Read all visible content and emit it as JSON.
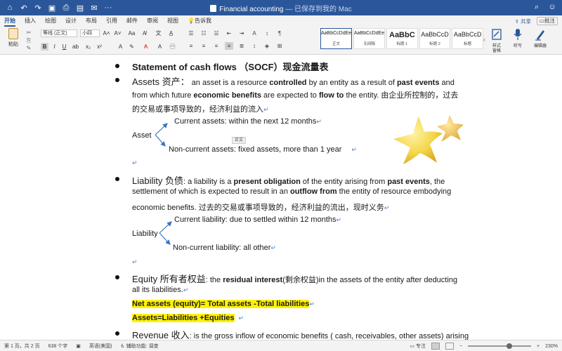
{
  "window": {
    "title": "Financial accounting",
    "subtitle": "— 已保存到我的 Mac"
  },
  "tabs": [
    "开始",
    "插入",
    "绘图",
    "设计",
    "布局",
    "引用",
    "邮件",
    "审阅",
    "视图"
  ],
  "tell_me": "告诉我",
  "share_label": "共享",
  "comments_label": "批注",
  "ribbon": {
    "paste_label": "粘贴",
    "font_name": "等线 (正文)",
    "font_size": "小四",
    "styles": [
      {
        "preview": "AaBbCcDdEe",
        "name": "正文"
      },
      {
        "preview": "AaBbCcDdEe",
        "name": "无间隔"
      },
      {
        "preview": "AaBbC",
        "name": "标题 1"
      },
      {
        "preview": "AaBbCcD",
        "name": "标题 2"
      },
      {
        "preview": "AaBbCcD",
        "name": "标题"
      }
    ],
    "styles_pane_label": "样式\n窗格",
    "dictate_label": "听写",
    "editor_label": "编辑器"
  },
  "document": {
    "line_top": "Statement of cash flows （SOCF）现金流量表",
    "assets_heading": "Assets 资产：",
    "assets_line1_a": " an asset is a resource ",
    "assets_line1_b": "controlled",
    "assets_line1_c": " by an entity as a result of ",
    "assets_line1_d": "past events",
    "assets_line1_e": " and",
    "assets_line2_a": "from which future ",
    "assets_line2_b": "economic benefits",
    "assets_line2_c": " are expected to ",
    "assets_line2_d": "flow to",
    "assets_line2_e": " the entity. 由企业所控制的，过去",
    "assets_line3": "的交易或事项导致的，经济利益的流入",
    "asset_label": "Asset",
    "current_assets": "Current assets: within the next 12 months",
    "noncurrent_assets": "Non-current assets: fixed assets, more than 1 year",
    "tooltip": "正文",
    "liability_heading": "Liability 负债",
    "liability_line1_a": ": a liability is a ",
    "liability_line1_b": "present obligation",
    "liability_line1_c": " of the entity arising from ",
    "liability_line1_d": "past events",
    "liability_line1_e": ", the",
    "liability_line2_a": "settlement of which is expected to result in an ",
    "liability_line2_b": "outflow from",
    "liability_line2_c": " the entity of resource embodying",
    "liability_line3": "economic benefits. 过去的交易或事项导致的，经济利益的流出，现时义务",
    "liability_label": "Liability",
    "current_liability": "Current liability: due to settled within 12 months",
    "noncurrent_liability": "Non-current liability: all other",
    "equity_heading": "Equity 所有者权益",
    "equity_line1_a": ": the ",
    "equity_line1_b": "residual interest",
    "equity_line1_c": "(剩余权益)in the assets of the entity after deducting",
    "equity_line2": "all its liabilities.",
    "net_assets": "Net assets (equity)= Total assets -Total liabilities",
    "accounting_eq": "Assets=Liabilities +Equities",
    "revenue_heading": "Revenue 收入",
    "revenue_line1": ": is the gross inflow of economic benefits ( cash, receivables, other assets) arising"
  },
  "statusbar": {
    "page": "第 1 页，共 2 页",
    "words": "638 个字",
    "language": "英语(美国)",
    "accessibility": "辅助功能: 调查",
    "focus": "专注",
    "zoom": "230%"
  },
  "colors": {
    "titlebar": "#2b579a",
    "highlight": "#fff200",
    "arrow": "#3f73c0"
  }
}
